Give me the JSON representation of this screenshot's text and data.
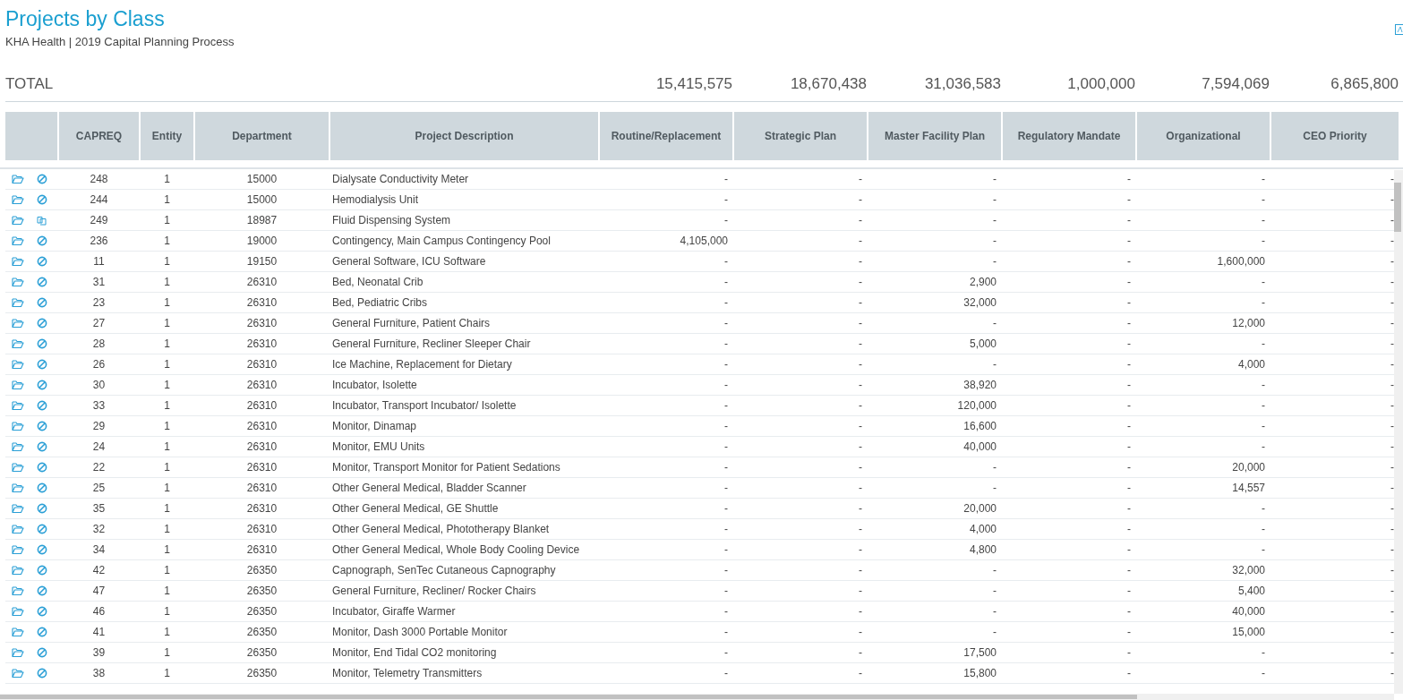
{
  "title": "Projects by Class",
  "subtitle": "KHA Health | 2019 Capital Planning Process",
  "total": {
    "label": "TOTAL",
    "values": [
      "15,415,575",
      "18,670,438",
      "31,036,583",
      "1,000,000",
      "7,594,069",
      "6,865,800"
    ]
  },
  "table": {
    "columns": [
      "CAPREQ",
      "Entity",
      "Department",
      "Project Description",
      "Routine/Replacement",
      "Strategic Plan",
      "Master Facility Plan",
      "Regulatory Mandate",
      "Organizational",
      "CEO Priority"
    ],
    "rows": [
      {
        "kind": "cancel",
        "capreq": "248",
        "entity": "1",
        "department": "15000",
        "description": "Dialysate Conductivity Meter",
        "values": [
          "-",
          "-",
          "-",
          "-",
          "-",
          "-"
        ]
      },
      {
        "kind": "cancel",
        "capreq": "244",
        "entity": "1",
        "department": "15000",
        "description": "Hemodialysis Unit",
        "values": [
          "-",
          "-",
          "-",
          "-",
          "-",
          "-"
        ]
      },
      {
        "kind": "copy",
        "capreq": "249",
        "entity": "1",
        "department": "18987",
        "description": "Fluid Dispensing System",
        "values": [
          "-",
          "-",
          "-",
          "-",
          "-",
          "-"
        ]
      },
      {
        "kind": "cancel",
        "capreq": "236",
        "entity": "1",
        "department": "19000",
        "description": "Contingency, Main Campus Contingency Pool",
        "values": [
          "4,105,000",
          "-",
          "-",
          "-",
          "-",
          "-"
        ]
      },
      {
        "kind": "cancel",
        "capreq": "11",
        "entity": "1",
        "department": "19150",
        "description": "General Software, ICU Software",
        "values": [
          "-",
          "-",
          "-",
          "-",
          "1,600,000",
          "-"
        ]
      },
      {
        "kind": "cancel",
        "capreq": "31",
        "entity": "1",
        "department": "26310",
        "description": "Bed, Neonatal Crib",
        "values": [
          "-",
          "-",
          "2,900",
          "-",
          "-",
          "-"
        ]
      },
      {
        "kind": "cancel",
        "capreq": "23",
        "entity": "1",
        "department": "26310",
        "description": "Bed, Pediatric Cribs",
        "values": [
          "-",
          "-",
          "32,000",
          "-",
          "-",
          "-"
        ]
      },
      {
        "kind": "cancel",
        "capreq": "27",
        "entity": "1",
        "department": "26310",
        "description": "General Furniture, Patient Chairs",
        "values": [
          "-",
          "-",
          "-",
          "-",
          "12,000",
          "-"
        ]
      },
      {
        "kind": "cancel",
        "capreq": "28",
        "entity": "1",
        "department": "26310",
        "description": "General Furniture, Recliner Sleeper Chair",
        "values": [
          "-",
          "-",
          "5,000",
          "-",
          "-",
          "-"
        ]
      },
      {
        "kind": "cancel",
        "capreq": "26",
        "entity": "1",
        "department": "26310",
        "description": "Ice Machine, Replacement for Dietary",
        "values": [
          "-",
          "-",
          "-",
          "-",
          "4,000",
          "-"
        ]
      },
      {
        "kind": "cancel",
        "capreq": "30",
        "entity": "1",
        "department": "26310",
        "description": "Incubator, Isolette",
        "values": [
          "-",
          "-",
          "38,920",
          "-",
          "-",
          "-"
        ]
      },
      {
        "kind": "cancel",
        "capreq": "33",
        "entity": "1",
        "department": "26310",
        "description": "Incubator, Transport Incubator/ Isolette",
        "values": [
          "-",
          "-",
          "120,000",
          "-",
          "-",
          "-"
        ]
      },
      {
        "kind": "cancel",
        "capreq": "29",
        "entity": "1",
        "department": "26310",
        "description": "Monitor, Dinamap",
        "values": [
          "-",
          "-",
          "16,600",
          "-",
          "-",
          "-"
        ]
      },
      {
        "kind": "cancel",
        "capreq": "24",
        "entity": "1",
        "department": "26310",
        "description": "Monitor, EMU Units",
        "values": [
          "-",
          "-",
          "40,000",
          "-",
          "-",
          "-"
        ]
      },
      {
        "kind": "cancel",
        "capreq": "22",
        "entity": "1",
        "department": "26310",
        "description": "Monitor, Transport Monitor for Patient Sedations",
        "values": [
          "-",
          "-",
          "-",
          "-",
          "20,000",
          "-"
        ]
      },
      {
        "kind": "cancel",
        "capreq": "25",
        "entity": "1",
        "department": "26310",
        "description": "Other General Medical, Bladder Scanner",
        "values": [
          "-",
          "-",
          "-",
          "-",
          "14,557",
          "-"
        ]
      },
      {
        "kind": "cancel",
        "capreq": "35",
        "entity": "1",
        "department": "26310",
        "description": "Other General Medical, GE Shuttle",
        "values": [
          "-",
          "-",
          "20,000",
          "-",
          "-",
          "-"
        ]
      },
      {
        "kind": "cancel",
        "capreq": "32",
        "entity": "1",
        "department": "26310",
        "description": "Other General Medical, Phototherapy Blanket",
        "values": [
          "-",
          "-",
          "4,000",
          "-",
          "-",
          "-"
        ]
      },
      {
        "kind": "cancel",
        "capreq": "34",
        "entity": "1",
        "department": "26310",
        "description": "Other General Medical, Whole Body Cooling Device",
        "values": [
          "-",
          "-",
          "4,800",
          "-",
          "-",
          "-"
        ]
      },
      {
        "kind": "cancel",
        "capreq": "42",
        "entity": "1",
        "department": "26350",
        "description": "Capnograph, SenTec Cutaneous Capnography",
        "values": [
          "-",
          "-",
          "-",
          "-",
          "32,000",
          "-"
        ]
      },
      {
        "kind": "cancel",
        "capreq": "47",
        "entity": "1",
        "department": "26350",
        "description": "General Furniture, Recliner/ Rocker Chairs",
        "values": [
          "-",
          "-",
          "-",
          "-",
          "5,400",
          "-"
        ]
      },
      {
        "kind": "cancel",
        "capreq": "46",
        "entity": "1",
        "department": "26350",
        "description": "Incubator, Giraffe Warmer",
        "values": [
          "-",
          "-",
          "-",
          "-",
          "40,000",
          "-"
        ]
      },
      {
        "kind": "cancel",
        "capreq": "41",
        "entity": "1",
        "department": "26350",
        "description": "Monitor, Dash 3000 Portable Monitor",
        "values": [
          "-",
          "-",
          "-",
          "-",
          "15,000",
          "-"
        ]
      },
      {
        "kind": "cancel",
        "capreq": "39",
        "entity": "1",
        "department": "26350",
        "description": "Monitor, End Tidal CO2 monitoring",
        "values": [
          "-",
          "-",
          "17,500",
          "-",
          "-",
          "-"
        ]
      },
      {
        "kind": "cancel",
        "capreq": "38",
        "entity": "1",
        "department": "26350",
        "description": "Monitor, Telemetry Transmitters",
        "values": [
          "-",
          "-",
          "15,800",
          "-",
          "-",
          "-"
        ]
      }
    ]
  }
}
